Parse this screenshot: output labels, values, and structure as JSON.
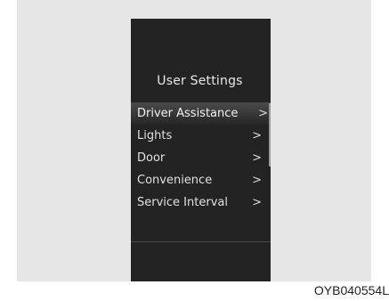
{
  "screen": {
    "title": "User Settings"
  },
  "menu": {
    "items": [
      {
        "label": "Driver Assistance",
        "icon": "chevron-right-icon",
        "selected": true
      },
      {
        "label": "Lights",
        "icon": "chevron-right-icon",
        "selected": false
      },
      {
        "label": "Door",
        "icon": "chevron-right-icon",
        "selected": false
      },
      {
        "label": "Convenience",
        "icon": "chevron-right-icon",
        "selected": false
      },
      {
        "label": "Service Interval",
        "icon": "chevron-right-icon",
        "selected": false
      }
    ],
    "chevron_glyph": ">"
  },
  "caption": "OYB040554L",
  "colors": {
    "display_background": "#232323",
    "panel_background": "#e6e6e6",
    "text": "#e0e0e0"
  }
}
